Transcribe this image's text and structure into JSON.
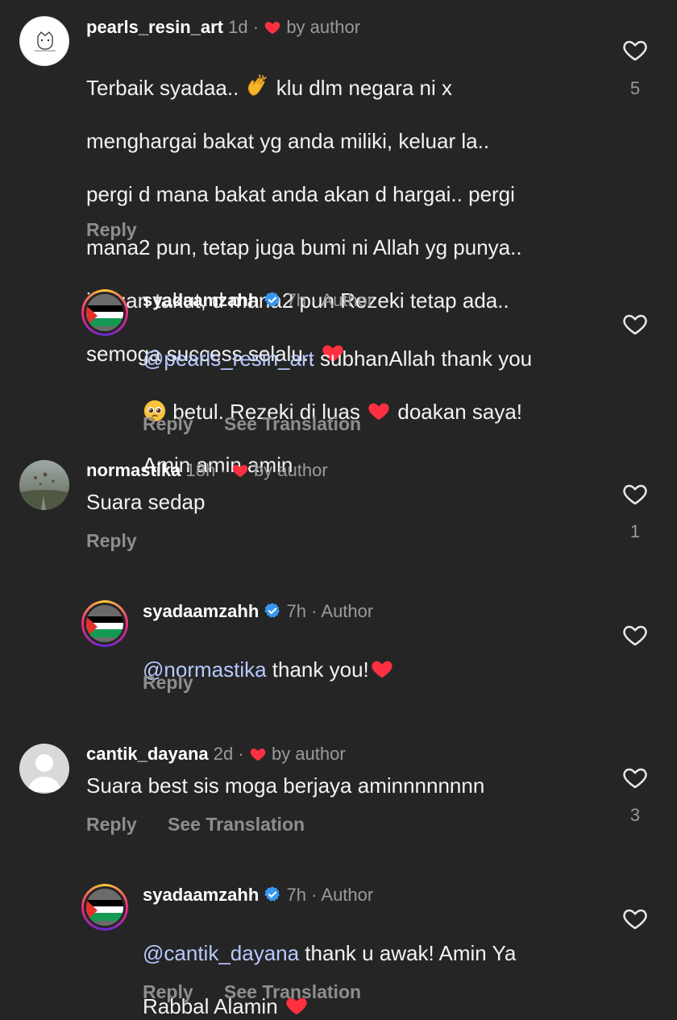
{
  "labels": {
    "reply": "Reply",
    "see_translation": "See Translation",
    "by_author": "by author",
    "author": "Author"
  },
  "comments": [
    {
      "username": "pearls_resin_art",
      "time": "1d",
      "text_lines": [
        "Terbaik syadaa.. ",
        " klu dlm negara ni x",
        "menghargai bakat yg anda miliki, keluar la..",
        "pergi d mana bakat anda akan d hargai.. pergi",
        "mana2 pun, tetap juga bumi ni Allah yg punya..",
        "jangan takut, d mana2 pun Rezeki tetap ada..",
        "semoga success selalu.. "
      ],
      "likes": "5"
    },
    {
      "username": "syadaamzahh",
      "time": "7h",
      "mention": "@pearls_resin_art",
      "text_a": " subhanAllah thank you",
      "text_b": " betul. Rezeki di luas ",
      "text_c": " doakan saya!",
      "text_d": "Amin amin amin"
    },
    {
      "username": "normastika",
      "time": "18h",
      "text": "Suara sedap",
      "likes": "1"
    },
    {
      "username": "syadaamzahh",
      "time": "7h",
      "mention": "@normastika",
      "text": " thank you!"
    },
    {
      "username": "cantik_dayana",
      "time": "2d",
      "text": "Suara best sis moga berjaya aminnnnnnnn",
      "likes": "3"
    },
    {
      "username": "syadaamzahh",
      "time": "7h",
      "mention": "@cantik_dayana",
      "text_a": " thank u awak! Amin Ya",
      "text_b": "Rabbal Alamin "
    }
  ],
  "colors": {
    "background": "#252525",
    "heart": "#ff3040",
    "verified": "#3897f0",
    "mention": "#b7c9ff",
    "muted": "#9a9a9a"
  }
}
